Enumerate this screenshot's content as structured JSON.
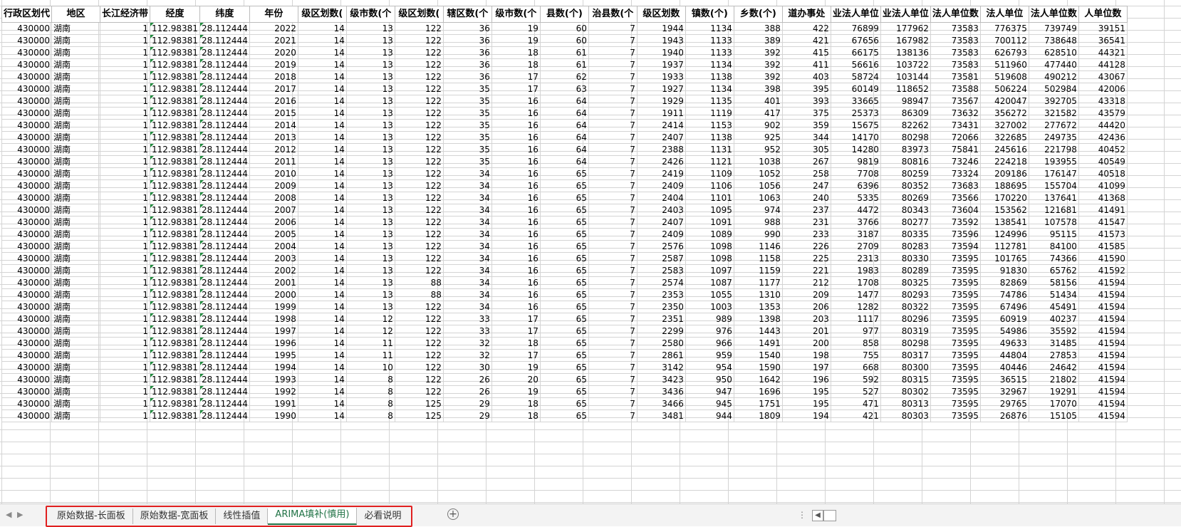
{
  "headers": [
    "行政区划代码",
    "地区",
    "长江经济带",
    "经度",
    "纬度",
    "年份",
    "地级区划数(个)",
    "地级市数(个)",
    "县级区划数(个)",
    "市辖区数(个)",
    "县级市数(个)",
    "县数(个)",
    "自治县数(个)",
    "乡级区划数",
    "镇数(个)",
    "乡数(个)",
    "街道办事处",
    "企业法人单位",
    "企业法人单位数",
    "事业法人单位数",
    "机关法人单位",
    "社团法人单位数",
    "其他法人单位数"
  ],
  "visible_headers": [
    "行政区划代",
    "地区",
    "长江经济带",
    "经度",
    "纬度",
    "年份",
    "级区划数(",
    "级市数(个",
    "级区划数(",
    "辖区数(个",
    "级市数(个",
    "县数(个)",
    "治县数(个",
    "级区划数",
    "镇数(个)",
    "乡数(个)",
    "道办事处",
    "业法人单位",
    "业法人单位",
    "法人单位数",
    "法人单位",
    "法人单位数",
    "人单位数"
  ],
  "rows": [
    [
      "430000",
      "湖南",
      "1",
      "112.98381",
      "28.112444",
      "2022",
      "14",
      "13",
      "122",
      "36",
      "19",
      "60",
      "7",
      "1944",
      "1134",
      "388",
      "422",
      "76899",
      "177962",
      "73583",
      "776375",
      "739749",
      "39151"
    ],
    [
      "430000",
      "湖南",
      "1",
      "112.98381",
      "28.112444",
      "2021",
      "14",
      "13",
      "122",
      "36",
      "19",
      "60",
      "7",
      "1943",
      "1133",
      "389",
      "421",
      "67656",
      "167982",
      "73583",
      "700112",
      "738648",
      "36541"
    ],
    [
      "430000",
      "湖南",
      "1",
      "112.98381",
      "28.112444",
      "2020",
      "14",
      "13",
      "122",
      "36",
      "18",
      "61",
      "7",
      "1940",
      "1133",
      "392",
      "415",
      "66175",
      "138136",
      "73583",
      "626793",
      "628510",
      "44321"
    ],
    [
      "430000",
      "湖南",
      "1",
      "112.98381",
      "28.112444",
      "2019",
      "14",
      "13",
      "122",
      "36",
      "18",
      "61",
      "7",
      "1937",
      "1134",
      "392",
      "411",
      "56616",
      "103722",
      "73583",
      "511960",
      "477440",
      "44128"
    ],
    [
      "430000",
      "湖南",
      "1",
      "112.98381",
      "28.112444",
      "2018",
      "14",
      "13",
      "122",
      "36",
      "17",
      "62",
      "7",
      "1933",
      "1138",
      "392",
      "403",
      "58724",
      "103144",
      "73581",
      "519608",
      "490212",
      "43067"
    ],
    [
      "430000",
      "湖南",
      "1",
      "112.98381",
      "28.112444",
      "2017",
      "14",
      "13",
      "122",
      "35",
      "17",
      "63",
      "7",
      "1927",
      "1134",
      "398",
      "395",
      "60149",
      "118652",
      "73588",
      "506224",
      "502984",
      "42006"
    ],
    [
      "430000",
      "湖南",
      "1",
      "112.98381",
      "28.112444",
      "2016",
      "14",
      "13",
      "122",
      "35",
      "16",
      "64",
      "7",
      "1929",
      "1135",
      "401",
      "393",
      "33665",
      "98947",
      "73567",
      "420047",
      "392705",
      "43318"
    ],
    [
      "430000",
      "湖南",
      "1",
      "112.98381",
      "28.112444",
      "2015",
      "14",
      "13",
      "122",
      "35",
      "16",
      "64",
      "7",
      "1911",
      "1119",
      "417",
      "375",
      "25373",
      "86309",
      "73632",
      "356272",
      "321582",
      "43579"
    ],
    [
      "430000",
      "湖南",
      "1",
      "112.98381",
      "28.112444",
      "2014",
      "14",
      "13",
      "122",
      "35",
      "16",
      "64",
      "7",
      "2414",
      "1153",
      "902",
      "359",
      "15675",
      "82262",
      "73431",
      "327002",
      "277672",
      "44420"
    ],
    [
      "430000",
      "湖南",
      "1",
      "112.98381",
      "28.112444",
      "2013",
      "14",
      "13",
      "122",
      "35",
      "16",
      "64",
      "7",
      "2407",
      "1138",
      "925",
      "344",
      "14170",
      "80298",
      "72066",
      "322685",
      "249735",
      "42436"
    ],
    [
      "430000",
      "湖南",
      "1",
      "112.98381",
      "28.112444",
      "2012",
      "14",
      "13",
      "122",
      "35",
      "16",
      "64",
      "7",
      "2388",
      "1131",
      "952",
      "305",
      "14280",
      "83973",
      "75841",
      "245616",
      "221798",
      "40452"
    ],
    [
      "430000",
      "湖南",
      "1",
      "112.98381",
      "28.112444",
      "2011",
      "14",
      "13",
      "122",
      "35",
      "16",
      "64",
      "7",
      "2426",
      "1121",
      "1038",
      "267",
      "9819",
      "80816",
      "73246",
      "224218",
      "193955",
      "40549"
    ],
    [
      "430000",
      "湖南",
      "1",
      "112.98381",
      "28.112444",
      "2010",
      "14",
      "13",
      "122",
      "34",
      "16",
      "65",
      "7",
      "2419",
      "1109",
      "1052",
      "258",
      "7708",
      "80259",
      "73324",
      "209186",
      "176147",
      "40518"
    ],
    [
      "430000",
      "湖南",
      "1",
      "112.98381",
      "28.112444",
      "2009",
      "14",
      "13",
      "122",
      "34",
      "16",
      "65",
      "7",
      "2409",
      "1106",
      "1056",
      "247",
      "6396",
      "80352",
      "73683",
      "188695",
      "155704",
      "41099"
    ],
    [
      "430000",
      "湖南",
      "1",
      "112.98381",
      "28.112444",
      "2008",
      "14",
      "13",
      "122",
      "34",
      "16",
      "65",
      "7",
      "2404",
      "1101",
      "1063",
      "240",
      "5335",
      "80269",
      "73566",
      "170220",
      "137641",
      "41368"
    ],
    [
      "430000",
      "湖南",
      "1",
      "112.98381",
      "28.112444",
      "2007",
      "14",
      "13",
      "122",
      "34",
      "16",
      "65",
      "7",
      "2403",
      "1095",
      "974",
      "237",
      "4472",
      "80343",
      "73604",
      "153562",
      "121681",
      "41491"
    ],
    [
      "430000",
      "湖南",
      "1",
      "112.98381",
      "28.112444",
      "2006",
      "14",
      "13",
      "122",
      "34",
      "16",
      "65",
      "7",
      "2407",
      "1091",
      "988",
      "231",
      "3766",
      "80277",
      "73592",
      "138541",
      "107578",
      "41547"
    ],
    [
      "430000",
      "湖南",
      "1",
      "112.98381",
      "28.112444",
      "2005",
      "14",
      "13",
      "122",
      "34",
      "16",
      "65",
      "7",
      "2409",
      "1089",
      "990",
      "233",
      "3187",
      "80335",
      "73596",
      "124996",
      "95115",
      "41573"
    ],
    [
      "430000",
      "湖南",
      "1",
      "112.98381",
      "28.112444",
      "2004",
      "14",
      "13",
      "122",
      "34",
      "16",
      "65",
      "7",
      "2576",
      "1098",
      "1146",
      "226",
      "2709",
      "80283",
      "73594",
      "112781",
      "84100",
      "41585"
    ],
    [
      "430000",
      "湖南",
      "1",
      "112.98381",
      "28.112444",
      "2003",
      "14",
      "13",
      "122",
      "34",
      "16",
      "65",
      "7",
      "2587",
      "1098",
      "1158",
      "225",
      "2313",
      "80330",
      "73595",
      "101765",
      "74366",
      "41590"
    ],
    [
      "430000",
      "湖南",
      "1",
      "112.98381",
      "28.112444",
      "2002",
      "14",
      "13",
      "122",
      "34",
      "16",
      "65",
      "7",
      "2583",
      "1097",
      "1159",
      "221",
      "1983",
      "80289",
      "73595",
      "91830",
      "65762",
      "41592"
    ],
    [
      "430000",
      "湖南",
      "1",
      "112.98381",
      "28.112444",
      "2001",
      "14",
      "13",
      "88",
      "34",
      "16",
      "65",
      "7",
      "2574",
      "1087",
      "1177",
      "212",
      "1708",
      "80325",
      "73595",
      "82869",
      "58156",
      "41594"
    ],
    [
      "430000",
      "湖南",
      "1",
      "112.98381",
      "28.112444",
      "2000",
      "14",
      "13",
      "88",
      "34",
      "16",
      "65",
      "7",
      "2353",
      "1055",
      "1310",
      "209",
      "1477",
      "80293",
      "73595",
      "74786",
      "51434",
      "41594"
    ],
    [
      "430000",
      "湖南",
      "1",
      "112.98381",
      "28.112444",
      "1999",
      "14",
      "13",
      "122",
      "34",
      "16",
      "65",
      "7",
      "2350",
      "1003",
      "1353",
      "206",
      "1282",
      "80322",
      "73595",
      "67496",
      "45491",
      "41594"
    ],
    [
      "430000",
      "湖南",
      "1",
      "112.98381",
      "28.112444",
      "1998",
      "14",
      "12",
      "122",
      "33",
      "17",
      "65",
      "7",
      "2351",
      "989",
      "1398",
      "203",
      "1117",
      "80296",
      "73595",
      "60919",
      "40237",
      "41594"
    ],
    [
      "430000",
      "湖南",
      "1",
      "112.98381",
      "28.112444",
      "1997",
      "14",
      "12",
      "122",
      "33",
      "17",
      "65",
      "7",
      "2299",
      "976",
      "1443",
      "201",
      "977",
      "80319",
      "73595",
      "54986",
      "35592",
      "41594"
    ],
    [
      "430000",
      "湖南",
      "1",
      "112.98381",
      "28.112444",
      "1996",
      "14",
      "11",
      "122",
      "32",
      "18",
      "65",
      "7",
      "2580",
      "966",
      "1491",
      "200",
      "858",
      "80298",
      "73595",
      "49633",
      "31485",
      "41594"
    ],
    [
      "430000",
      "湖南",
      "1",
      "112.98381",
      "28.112444",
      "1995",
      "14",
      "11",
      "122",
      "32",
      "17",
      "65",
      "7",
      "2861",
      "959",
      "1540",
      "198",
      "755",
      "80317",
      "73595",
      "44804",
      "27853",
      "41594"
    ],
    [
      "430000",
      "湖南",
      "1",
      "112.98381",
      "28.112444",
      "1994",
      "14",
      "10",
      "122",
      "30",
      "19",
      "65",
      "7",
      "3142",
      "954",
      "1590",
      "197",
      "668",
      "80300",
      "73595",
      "40446",
      "24642",
      "41594"
    ],
    [
      "430000",
      "湖南",
      "1",
      "112.98381",
      "28.112444",
      "1993",
      "14",
      "8",
      "122",
      "26",
      "20",
      "65",
      "7",
      "3423",
      "950",
      "1642",
      "196",
      "592",
      "80315",
      "73595",
      "36515",
      "21802",
      "41594"
    ],
    [
      "430000",
      "湖南",
      "1",
      "112.98381",
      "28.112444",
      "1992",
      "14",
      "8",
      "122",
      "26",
      "19",
      "65",
      "7",
      "3436",
      "947",
      "1696",
      "195",
      "527",
      "80302",
      "73595",
      "32967",
      "19291",
      "41594"
    ],
    [
      "430000",
      "湖南",
      "1",
      "112.98381",
      "28.112444",
      "1991",
      "14",
      "8",
      "125",
      "29",
      "18",
      "65",
      "7",
      "3466",
      "945",
      "1751",
      "195",
      "471",
      "80313",
      "73595",
      "29765",
      "17070",
      "41594"
    ],
    [
      "430000",
      "湖南",
      "1",
      "112.98381",
      "28.112444",
      "1990",
      "14",
      "8",
      "125",
      "29",
      "18",
      "65",
      "7",
      "3481",
      "944",
      "1809",
      "194",
      "421",
      "80303",
      "73595",
      "26876",
      "15105",
      "41594"
    ]
  ],
  "sheet_tabs": [
    "原始数据-长面板",
    "原始数据-宽面板",
    "线性插值",
    "ARIMA填补(慎用)",
    "必看说明"
  ],
  "active_tab": "ARIMA填补(慎用)",
  "icons": {
    "nav_left": "nav-left-icon",
    "add_sheet": "add-sheet-icon",
    "scroll_left": "scroll-left-icon"
  },
  "colors": {
    "active_tab_text": "#217346",
    "highlight_border": "#e02020",
    "cell_flag": "#1e8a3c"
  }
}
